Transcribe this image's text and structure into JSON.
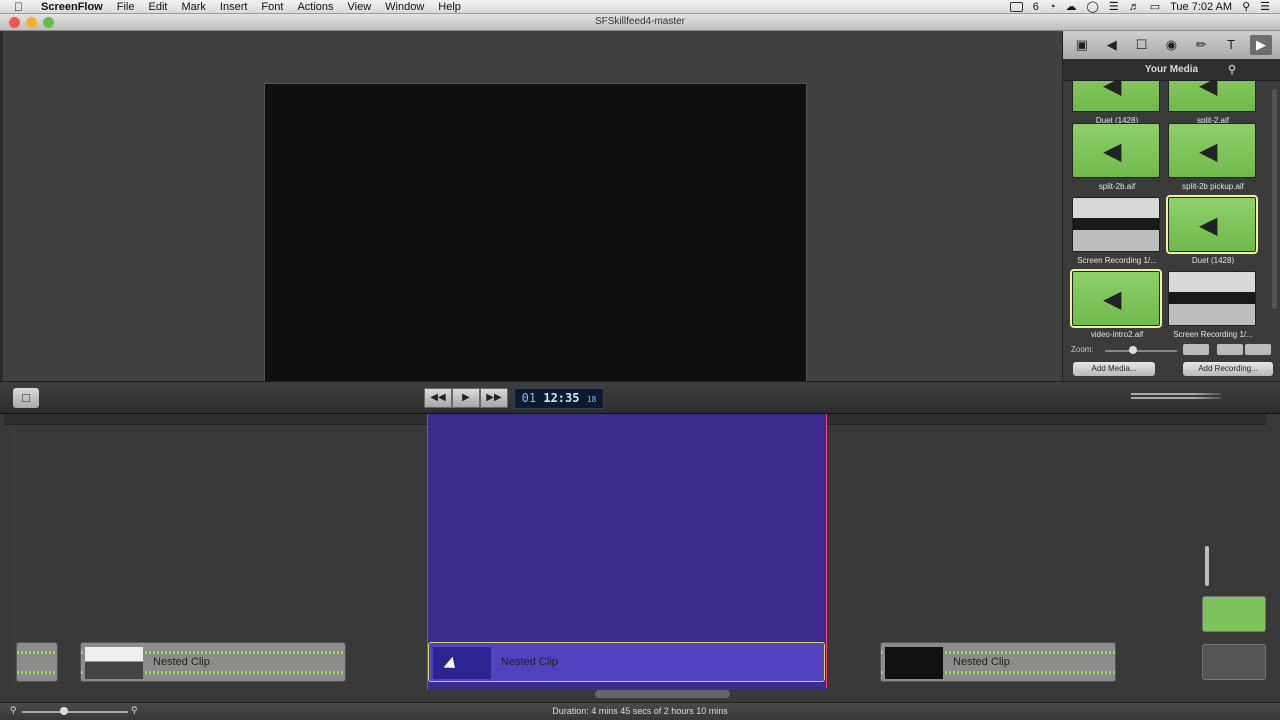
{
  "menubar": {
    "apple": "",
    "app": "ScreenFlow",
    "items": [
      "File",
      "Edit",
      "Mark",
      "Insert",
      "Font",
      "Actions",
      "View",
      "Window",
      "Help"
    ],
    "badge": "6",
    "clock": "Tue 7:02 AM"
  },
  "window": {
    "title": "SFSkillfeed4-master",
    "colors": {
      "close": "#f35a4a",
      "minimize": "#f5b12b",
      "zoom": "#5bc440"
    }
  },
  "sidebar": {
    "toolbar_icons": [
      "video-icon",
      "audio-icon",
      "screen-icon",
      "callout-icon",
      "annotation-icon",
      "text-icon",
      "media-icon"
    ],
    "header": "Your Media",
    "media": [
      {
        "caption": "Duet (1428)",
        "kind": "audio",
        "selected": false
      },
      {
        "caption": "split-2.aif",
        "kind": "audio",
        "selected": false
      },
      {
        "caption": "split-2b.aif",
        "kind": "audio",
        "selected": false
      },
      {
        "caption": "split-2b pickup.aif",
        "kind": "audio",
        "selected": false
      },
      {
        "caption": "Screen Recording 1/...",
        "kind": "video",
        "selected": false
      },
      {
        "caption": "Duet (1428)",
        "kind": "audio",
        "selected": true
      },
      {
        "caption": "video-intro2.aif",
        "kind": "audio",
        "selected": true
      },
      {
        "caption": "Screen Recording 1/...",
        "kind": "video",
        "selected": false
      }
    ],
    "zoom_label": "Zoom:",
    "add_media": "Add Media...",
    "add_recording": "Add Recording..."
  },
  "controls": {
    "timecode_prefix": "01",
    "timecode": "12:35",
    "timecode_frames": "18"
  },
  "timeline": {
    "clips": [
      {
        "label": "Nested Clip",
        "selected": false
      },
      {
        "label": "Nested Clip",
        "selected": true
      },
      {
        "label": "Nested Clip",
        "selected": false
      }
    ]
  },
  "status": {
    "duration": "Duration: 4 mins 45 secs of 2 hours 10 mins"
  }
}
